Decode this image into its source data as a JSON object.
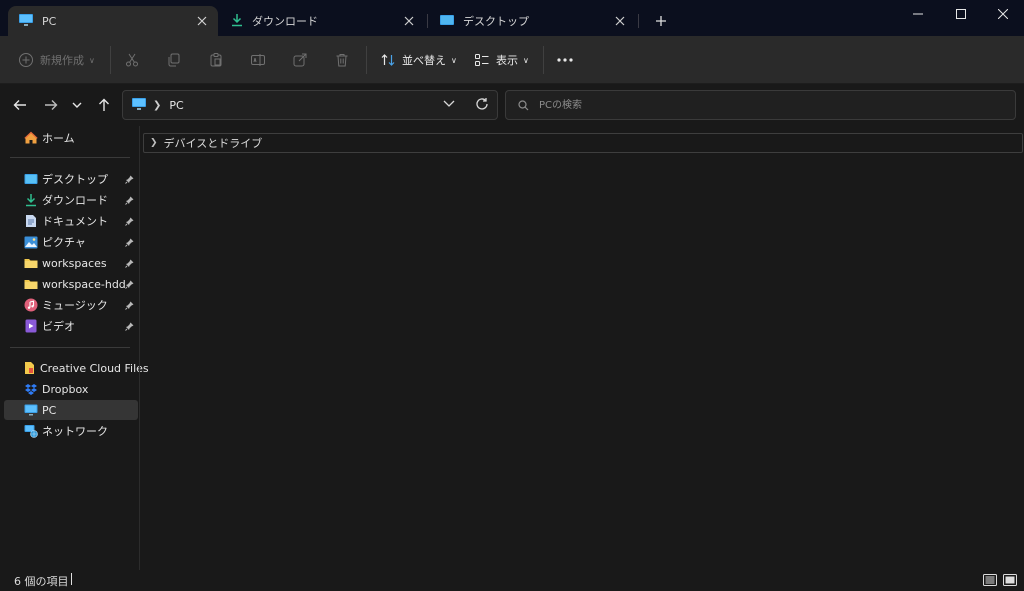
{
  "tabs": [
    {
      "label": "PC",
      "icon": "monitor-icon",
      "active": true
    },
    {
      "label": "ダウンロード",
      "icon": "download-icon",
      "active": false
    },
    {
      "label": "デスクトップ",
      "icon": "desktop-icon",
      "active": false
    }
  ],
  "toolbar": {
    "new_label": "新規作成",
    "sort_label": "並べ替え",
    "view_label": "表示"
  },
  "address": {
    "crumb": "PC"
  },
  "search": {
    "placeholder": "PCの検索"
  },
  "sidebar": {
    "home": "ホーム",
    "pinned": [
      {
        "label": "デスクトップ",
        "icon": "desktop-icon"
      },
      {
        "label": "ダウンロード",
        "icon": "download-icon"
      },
      {
        "label": "ドキュメント",
        "icon": "document-icon"
      },
      {
        "label": "ピクチャ",
        "icon": "pictures-icon"
      },
      {
        "label": "workspaces",
        "icon": "folder-icon"
      },
      {
        "label": "workspace-hdd",
        "icon": "folder-icon"
      },
      {
        "label": "ミュージック",
        "icon": "music-icon"
      },
      {
        "label": "ビデオ",
        "icon": "video-icon"
      }
    ],
    "locations": [
      {
        "label": "Creative Cloud Files",
        "icon": "creative-cloud-icon"
      },
      {
        "label": "Dropbox",
        "icon": "dropbox-icon"
      },
      {
        "label": "PC",
        "icon": "monitor-icon",
        "selected": true
      },
      {
        "label": "ネットワーク",
        "icon": "network-icon"
      }
    ]
  },
  "content": {
    "group_header": "デバイスとドライブ"
  },
  "status": {
    "count": "6 個の項目"
  },
  "colors": {
    "titlebar": "#0b0f1e",
    "toolbar": "#2a2a2a",
    "background": "#191919",
    "selected": "#353535",
    "accent_blue": "#3aa0e8",
    "folder_yellow": "#f2c94c"
  }
}
